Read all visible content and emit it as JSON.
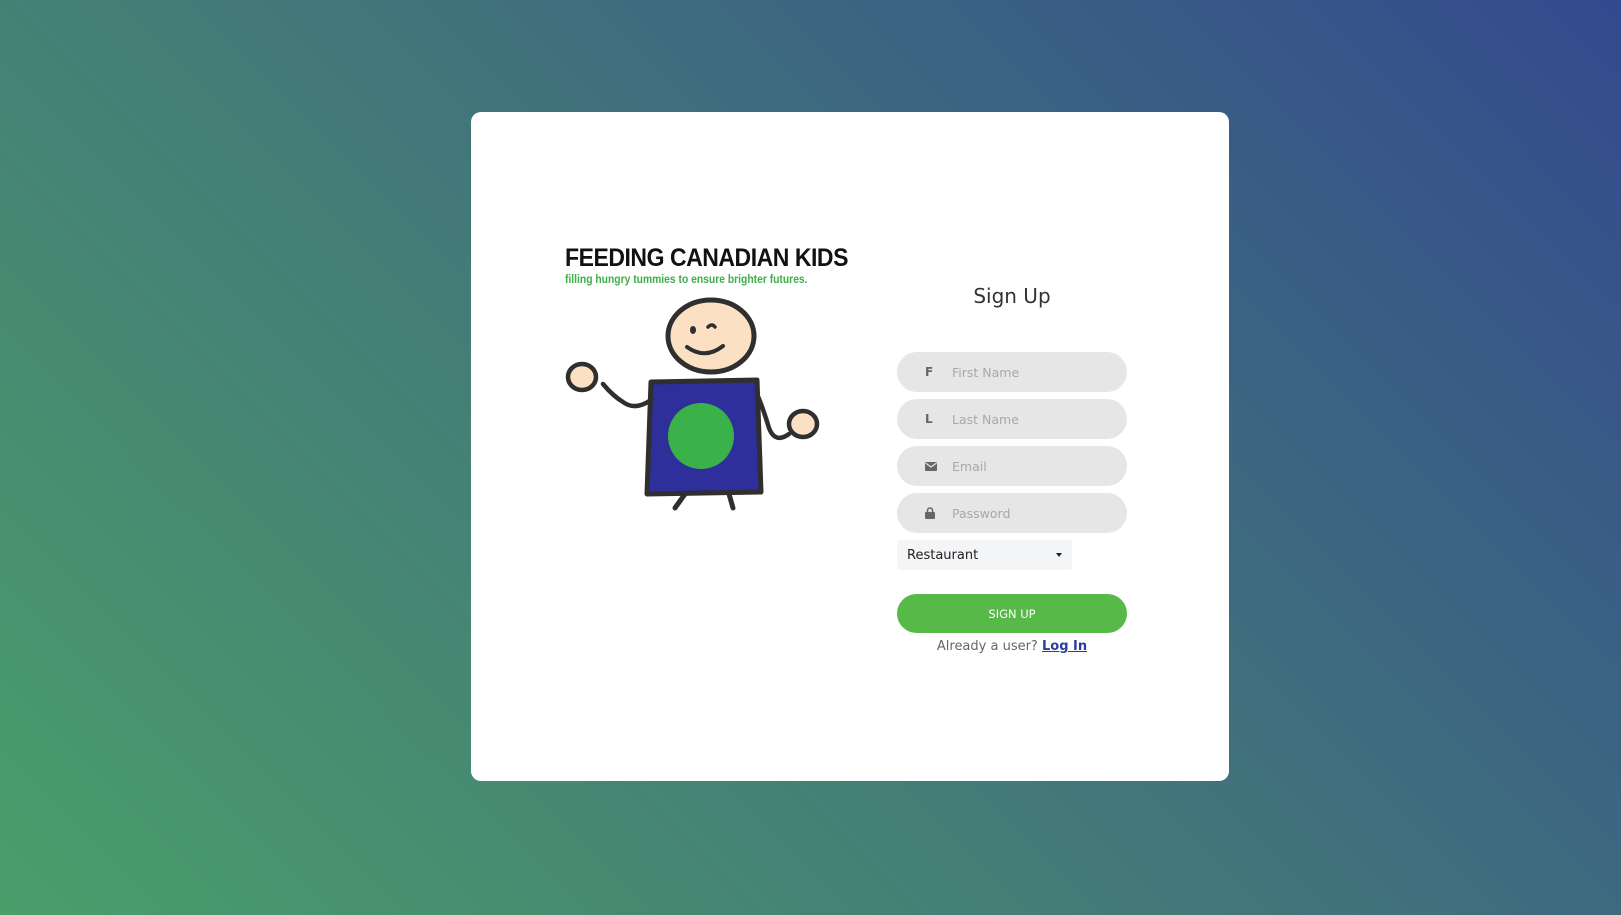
{
  "brand": {
    "title": "FEEDING CANADIAN KIDS",
    "tagline": "filling hungry tummies to ensure brighter futures."
  },
  "form": {
    "title": "Sign Up",
    "fields": {
      "first_name": {
        "icon_text": "F",
        "placeholder": "First Name",
        "value": ""
      },
      "last_name": {
        "icon_text": "L",
        "placeholder": "Last Name",
        "value": ""
      },
      "email": {
        "icon": "envelope-icon",
        "placeholder": "Email",
        "value": ""
      },
      "password": {
        "icon": "lock-icon",
        "placeholder": "Password",
        "value": ""
      }
    },
    "user_type": {
      "selected": "Restaurant",
      "icon": "caret-down-icon"
    },
    "submit_label": "SIGN UP",
    "login_prompt": "Already a user?",
    "login_link": "Log In"
  },
  "colors": {
    "primary_green": "#57b947",
    "mascot_shirt": "#2e2f9a",
    "mascot_emblem": "#3bb14a",
    "mascot_skin": "#fce0c4",
    "link": "#2a3ea0"
  }
}
